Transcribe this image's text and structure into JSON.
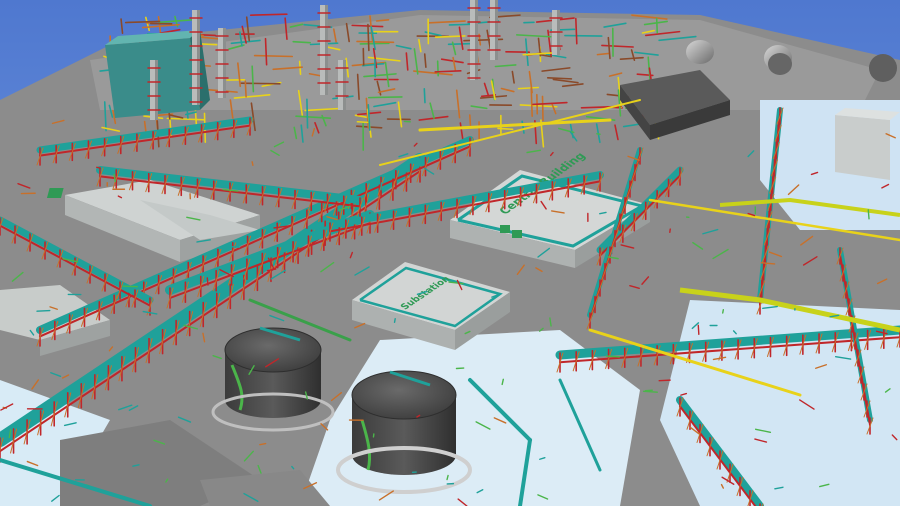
{
  "scene": {
    "kind": "3D plant model render",
    "colors": {
      "sky": "#5b82d6",
      "ground": "#8a8a8a",
      "ground_light": "#a3a3a3",
      "paved_light": "#d9ecf7",
      "pipe_teal": "#1fa19a",
      "pipe_red": "#c0262a",
      "pipe_yellow": "#e8d21a",
      "pipe_green": "#4bb54a",
      "steel_orange": "#c8702a",
      "tank_dark": "#4a4a4a",
      "building_light": "#cfd3d2"
    }
  },
  "labels": {
    "central_building": "Central Building",
    "substation": "Substation",
    "roof_left": "",
    "roof_small": ""
  }
}
